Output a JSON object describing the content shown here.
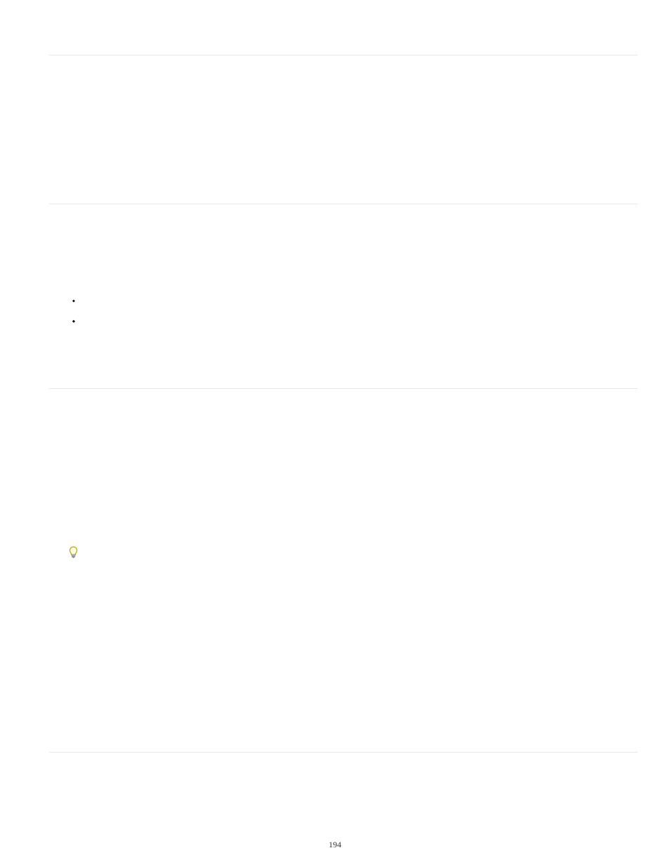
{
  "page": {
    "number": "194"
  },
  "bullets": {
    "item1": "",
    "item2": "",
    "item3": ""
  }
}
